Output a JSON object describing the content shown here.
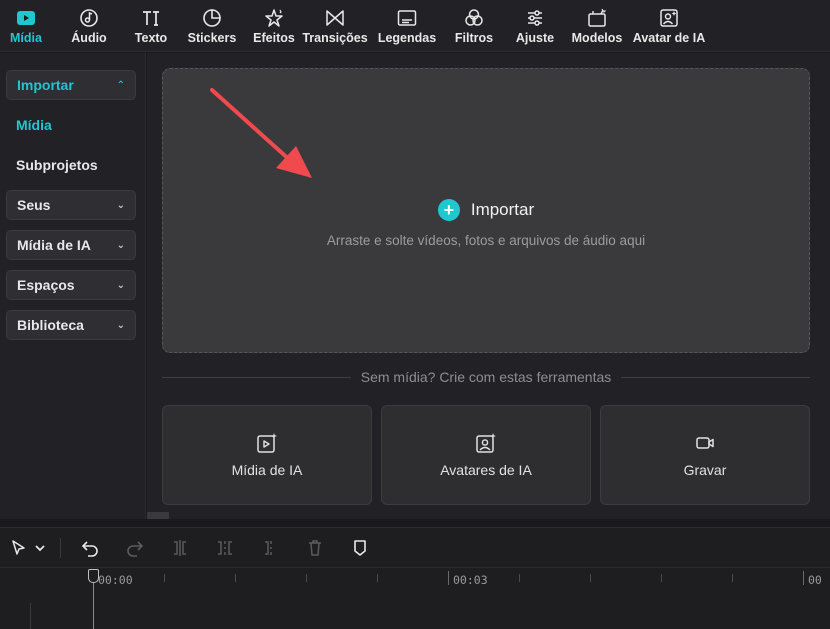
{
  "toolbar": {
    "items": [
      {
        "label": "Mídia",
        "icon": "play-square-icon",
        "active": true
      },
      {
        "label": "Áudio",
        "icon": "music-note-icon",
        "active": false
      },
      {
        "label": "Texto",
        "icon": "text-icon",
        "active": false
      },
      {
        "label": "Stickers",
        "icon": "sticker-icon",
        "active": false
      },
      {
        "label": "Efeitos",
        "icon": "sparkle-star-icon",
        "active": false
      },
      {
        "label": "Transições",
        "icon": "transition-icon",
        "active": false
      },
      {
        "label": "Legendas",
        "icon": "captions-icon",
        "active": false
      },
      {
        "label": "Filtros",
        "icon": "filters-icon",
        "active": false
      },
      {
        "label": "Ajuste",
        "icon": "sliders-icon",
        "active": false
      },
      {
        "label": "Modelos",
        "icon": "templates-icon",
        "active": false
      },
      {
        "label": "Avatar de IA",
        "icon": "ai-avatar-icon",
        "active": false
      }
    ]
  },
  "sidebar": {
    "import_label": "Importar",
    "media_label": "Mídia",
    "subprojects_label": "Subprojetos",
    "sections": [
      "Seus",
      "Mídia de IA",
      "Espaços",
      "Biblioteca"
    ]
  },
  "main": {
    "import_label": "Importar",
    "drop_hint": "Arraste e solte vídeos, fotos e arquivos de áudio aqui",
    "divider_text": "Sem mídia? Crie com estas ferramentas",
    "cards": [
      {
        "label": "Mídia de IA",
        "icon": "ai-media-icon"
      },
      {
        "label": "Avatares de IA",
        "icon": "ai-avatar-card-icon"
      },
      {
        "label": "Gravar",
        "icon": "record-camera-icon"
      }
    ]
  },
  "timeline": {
    "tools": [
      "select-cursor-icon",
      "chevron-down-icon",
      "undo-icon",
      "redo-icon",
      "split-icon",
      "split-left-icon",
      "split-right-icon",
      "delete-icon",
      "marker-icon"
    ],
    "time_labels": [
      "00:00",
      "00:03",
      "00"
    ]
  },
  "colors": {
    "accent": "#1fc7cf",
    "annotation_arrow": "#f04a4e"
  }
}
